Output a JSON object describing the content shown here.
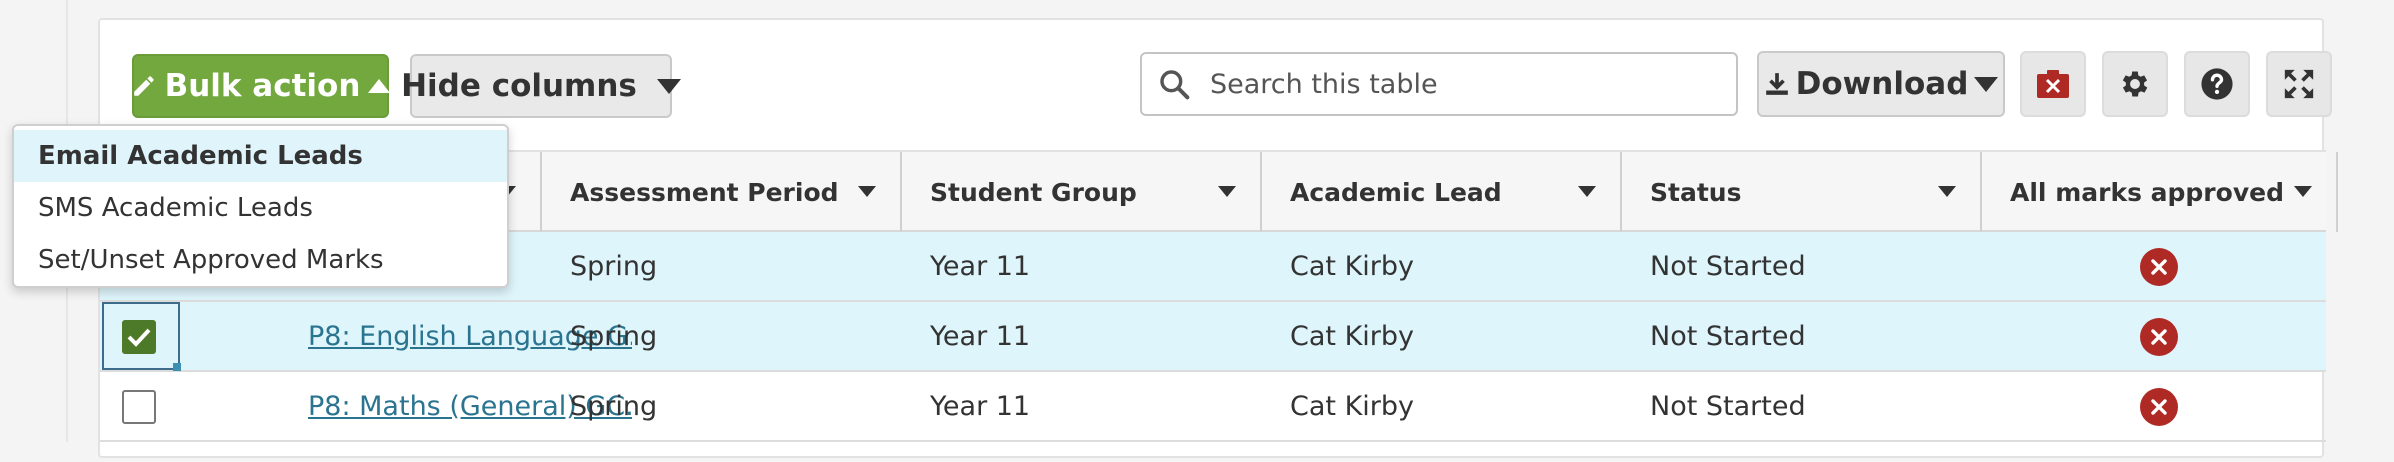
{
  "toolbar": {
    "bulk_action_label": "Bulk action",
    "hide_columns_label": "Hide columns",
    "search_placeholder": "Search this table",
    "download_label": "Download"
  },
  "bulk_menu": {
    "items": [
      {
        "label": "Email Academic Leads",
        "active": true
      },
      {
        "label": "SMS Academic Leads",
        "active": false
      },
      {
        "label": "Set/Unset Approved Marks",
        "active": false
      }
    ]
  },
  "table": {
    "columns": [
      "Assessment Period",
      "Student Group",
      "Academic Lead",
      "Status",
      "All marks approved"
    ],
    "rows": [
      {
        "checked": false,
        "assessment": "",
        "period": "Spring",
        "group": "Year 11",
        "lead": "Cat Kirby",
        "status": "Not Started",
        "approved": false
      },
      {
        "checked": true,
        "assessment": "P8: English Language G...",
        "period": "Spring",
        "group": "Year 11",
        "lead": "Cat Kirby",
        "status": "Not Started",
        "approved": false
      },
      {
        "checked": false,
        "assessment": "P8: Maths (General) GC...",
        "period": "Spring",
        "group": "Year 11",
        "lead": "Cat Kirby",
        "status": "Not Started",
        "approved": false
      }
    ]
  },
  "colors": {
    "primary_green": "#72a83e",
    "selected_row": "#def5fb",
    "not_approved_red": "#b02a25",
    "link_teal": "#2a7490"
  },
  "icons": [
    "pencil-icon",
    "caret-up-icon",
    "caret-down-icon",
    "search-icon",
    "download-icon",
    "clear-filter-icon",
    "gear-icon",
    "help-icon",
    "expand-icon",
    "x-circle-icon",
    "checkmark-icon"
  ]
}
